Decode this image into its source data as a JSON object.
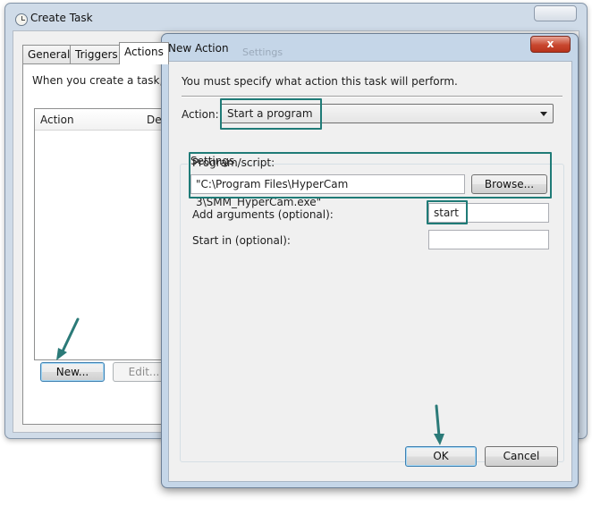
{
  "create_task": {
    "title": "Create Task",
    "tabs": [
      {
        "label": "General"
      },
      {
        "label": "Triggers"
      },
      {
        "label": "Actions"
      }
    ],
    "description": "When you create a task, yo",
    "list_columns": [
      "Action",
      "De"
    ],
    "new_button": "New...",
    "edit_button": "Edit..."
  },
  "new_action": {
    "title": "New Action",
    "ghost_title": "Settings",
    "close_label": "x",
    "instruction": "You must specify what action this task will perform.",
    "action_label": "Action:",
    "action_value": "Start a program",
    "settings_legend": "Settings",
    "program_label": "Program/script:",
    "program_value": "\"C:\\Program Files\\HyperCam 3\\SMM_HyperCam.exe\"",
    "browse_button": "Browse...",
    "arguments_label": "Add arguments (optional):",
    "arguments_value": "start",
    "start_in_label": "Start in (optional):",
    "start_in_value": "",
    "ok_button": "OK",
    "cancel_button": "Cancel"
  },
  "colors": {
    "highlight": "#1f7b77",
    "arrow": "#2b7a78"
  },
  "icons": {
    "app_icon": "clock-icon",
    "pointer": "arrow-icon"
  }
}
